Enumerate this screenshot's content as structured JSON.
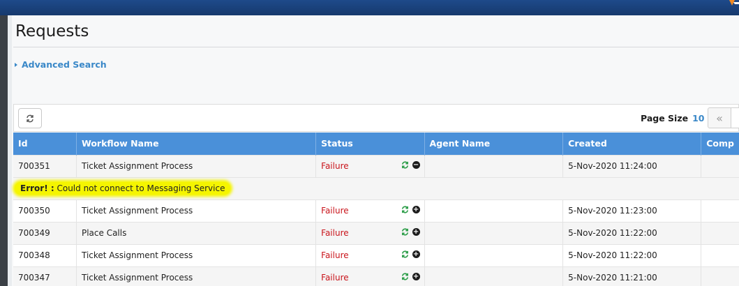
{
  "page": {
    "title": "Requests"
  },
  "search": {
    "advanced_label": "Advanced Search"
  },
  "toolbar": {
    "page_size_label": "Page Size",
    "page_size_value": "10",
    "first_page_symbol": "«"
  },
  "table": {
    "headers": [
      "Id",
      "Workflow Name",
      "Status",
      "Agent Name",
      "Created",
      "Comp"
    ],
    "rows": [
      {
        "id": "700351",
        "workflow": "Ticket Assignment Process",
        "status": "Failure",
        "agent": "",
        "created": "5-Nov-2020 11:24:00",
        "expanded": true
      },
      {
        "id": "700350",
        "workflow": "Ticket Assignment Process",
        "status": "Failure",
        "agent": "",
        "created": "5-Nov-2020 11:23:00",
        "expanded": false
      },
      {
        "id": "700349",
        "workflow": "Place Calls",
        "status": "Failure",
        "agent": "",
        "created": "5-Nov-2020 11:22:00",
        "expanded": false
      },
      {
        "id": "700348",
        "workflow": "Ticket Assignment Process",
        "status": "Failure",
        "agent": "",
        "created": "5-Nov-2020 11:22:00",
        "expanded": false
      },
      {
        "id": "700347",
        "workflow": "Ticket Assignment Process",
        "status": "Failure",
        "agent": "",
        "created": "5-Nov-2020 11:21:00",
        "expanded": false
      }
    ],
    "error": {
      "prefix": "Error! :",
      "message": " Could not connect to Messaging Service"
    }
  },
  "icons": {
    "refresh": "refresh-icon",
    "retry": "retry-icon",
    "collapse": "minus-circle-icon",
    "expand": "plus-circle-icon"
  },
  "colors": {
    "header_bg": "#4a90d9",
    "failure": "#c9141b",
    "link": "#3a88c8",
    "retry_green": "#2e9e4a",
    "highlight": "#f5f500"
  }
}
